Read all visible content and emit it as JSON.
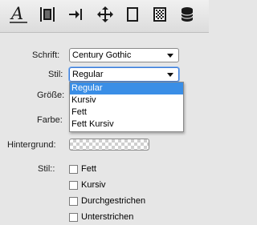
{
  "toolbar": {
    "buttons": [
      {
        "icon": "text-style-icon"
      },
      {
        "icon": "align-icon"
      },
      {
        "icon": "indent-arrow-icon"
      },
      {
        "icon": "move-icon"
      },
      {
        "icon": "rectangle-icon"
      },
      {
        "icon": "pattern-icon"
      },
      {
        "icon": "database-icon"
      }
    ]
  },
  "form": {
    "font_label": "Schrift:",
    "font_value": "Century Gothic",
    "style_label": "Stil:",
    "style_value": "Regular",
    "size_label": "Größe:",
    "color_label": "Farbe:",
    "background_label": "Hintergrund:",
    "style2_label": "Stil::"
  },
  "dropdown": {
    "options": [
      "Regular",
      "Kursiv",
      "Fett",
      "Fett Kursiv"
    ],
    "selected": "Regular"
  },
  "checkboxes": [
    {
      "label": "Fett",
      "checked": false
    },
    {
      "label": "Kursiv",
      "checked": false
    },
    {
      "label": "Durchgestrichen",
      "checked": false
    },
    {
      "label": "Unterstrichen",
      "checked": false
    }
  ],
  "colors": {
    "selection": "#3a8ee6",
    "focus_border": "#3d7bd6"
  }
}
